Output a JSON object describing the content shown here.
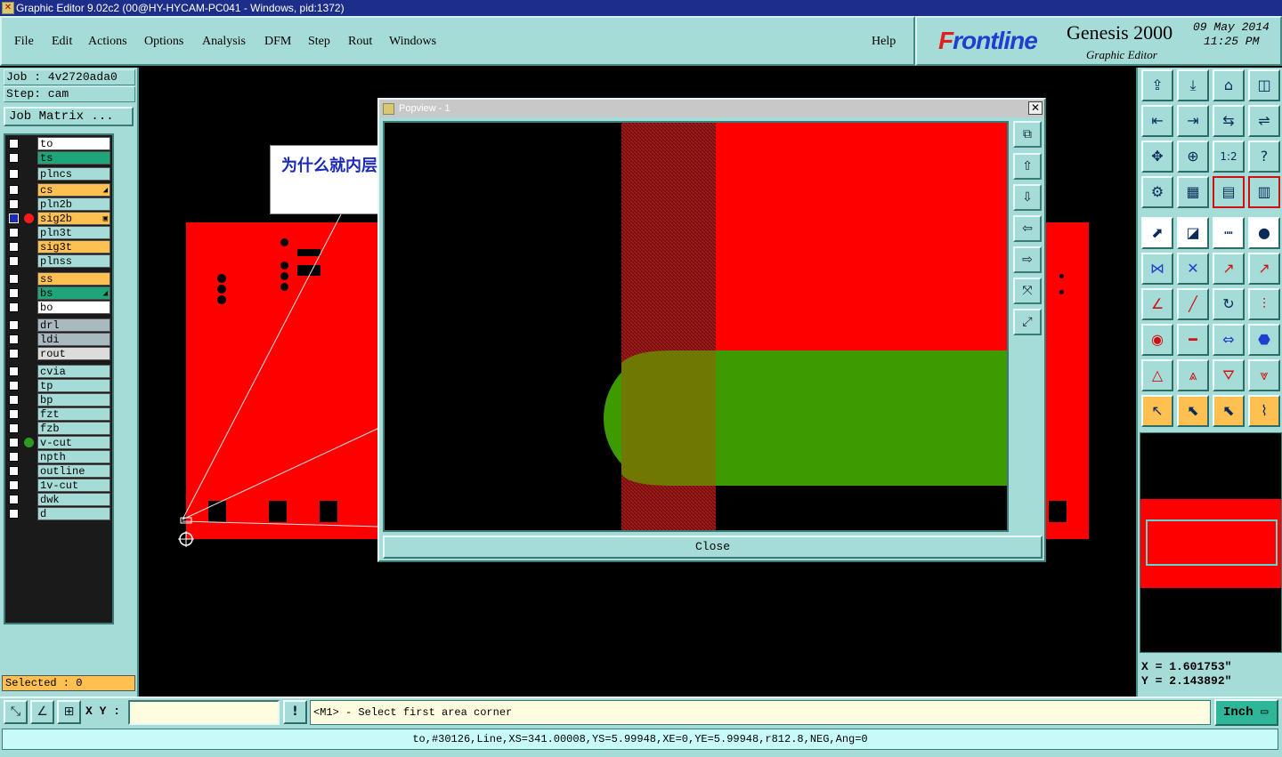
{
  "window": {
    "title": "Graphic Editor 9.02c2 (00@HY-HYCAM-PC041 - Windows, pid:1372)"
  },
  "menu": {
    "items": [
      {
        "label": "File"
      },
      {
        "label": "Edit"
      },
      {
        "label": "Actions"
      },
      {
        "label": "Options"
      },
      {
        "label": "Analysis"
      },
      {
        "label": "DFM"
      },
      {
        "label": "Step"
      },
      {
        "label": "Rout"
      },
      {
        "label": "Windows"
      }
    ],
    "help": "Help"
  },
  "brand": {
    "logo_rest": "rontline",
    "logo_f": "F",
    "product": "Genesis 2000",
    "subtitle": "Graphic Editor",
    "date": "09 May 2014",
    "time": "11:25 PM"
  },
  "job": {
    "job_label": "Job : 4v2720ada0",
    "step_label": "Step: cam",
    "matrix_button": "Job Matrix ..."
  },
  "layers": [
    {
      "name": "to",
      "color": "#ffffff"
    },
    {
      "name": "ts",
      "color": "#1ea57a"
    },
    {
      "name": "plncs",
      "color": "#a6dcd7"
    },
    {
      "name": "cs",
      "color": "#ffc052",
      "mark": "◢"
    },
    {
      "name": "pln2b",
      "color": "#a6dcd7"
    },
    {
      "name": "sig2b",
      "color": "#ffc052",
      "mark": "▣",
      "active": true
    },
    {
      "name": "pln3t",
      "color": "#a6dcd7"
    },
    {
      "name": "sig3t",
      "color": "#ffc052"
    },
    {
      "name": "plnss",
      "color": "#a6dcd7"
    },
    {
      "name": "ss",
      "color": "#ffc052"
    },
    {
      "name": "bs",
      "color": "#1ea57a",
      "mark": "◢"
    },
    {
      "name": "bo",
      "color": "#ffffff"
    },
    {
      "name": "drl",
      "color": "#a9b9c0"
    },
    {
      "name": "ldi",
      "color": "#a9b9c0"
    },
    {
      "name": "rout",
      "color": "#dcdcdc"
    },
    {
      "name": "cvia",
      "color": "#a6dcd7"
    },
    {
      "name": "tp",
      "color": "#a6dcd7"
    },
    {
      "name": "bp",
      "color": "#a6dcd7"
    },
    {
      "name": "fzt",
      "color": "#a6dcd7"
    },
    {
      "name": "fzb",
      "color": "#a6dcd7"
    },
    {
      "name": "v-cut",
      "color": "#a6dcd7",
      "dot": "#2e9a24"
    },
    {
      "name": "npth",
      "color": "#a6dcd7"
    },
    {
      "name": "outline",
      "color": "#a6dcd7"
    },
    {
      "name": "1v-cut",
      "color": "#a6dcd7"
    },
    {
      "name": "dwk",
      "color": "#a6dcd7"
    },
    {
      "name": "d",
      "color": "#a6dcd7"
    }
  ],
  "selected_label": "Selected : 0",
  "annotation": {
    "text": "为什么就内层没削铜?"
  },
  "popview": {
    "title": "Popview - 1",
    "close_x": "✕",
    "close_button": "Close"
  },
  "coords": {
    "x": "X = 1.601753\"",
    "y": "Y = 2.143892\""
  },
  "bottom": {
    "xy_label": "X Y :",
    "xy_value": "",
    "warn": "!",
    "prompt": "<M1> - Select first area corner",
    "unit": "Inch ▭"
  },
  "status": "to,#30126,Line,XS=341.00008,YS=5.99948,XE=0,YE=5.99948,r812.8,NEG,Ang=0",
  "colors": {
    "panel": "#a6dcd7",
    "copper": "#ff0000",
    "feature": "#2e9a24",
    "highlight": "#ffc052"
  }
}
